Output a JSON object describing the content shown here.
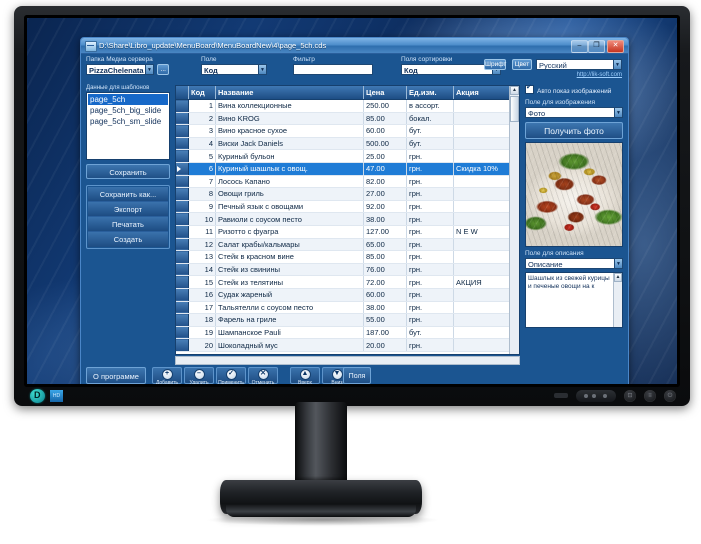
{
  "window": {
    "title": "D:\\Share\\Libro_update\\MenuBoard\\MenuBoardNew\\4\\page_5ch.cds",
    "minimize": "–",
    "maximize": "❐",
    "close": "✕"
  },
  "toolbar": {
    "media_folder_label": "Папка Медиа сервера",
    "media_folder_value": "PizzaChelenata",
    "browse_label": "...",
    "field_label": "Поле",
    "field_value": "Код",
    "filter_label": "Фильтр",
    "filter_value": "",
    "sort_label": "Поля сортировки",
    "sort_value": "Код",
    "font_button": "Шрифт",
    "color_button": "Цвет",
    "language_value": "Русский",
    "link": "http://lik-soft.com"
  },
  "left_panel": {
    "list_label": "Данные для шаблонов",
    "items": [
      {
        "label": "page_5ch",
        "selected": true
      },
      {
        "label": "page_5ch_big_slide",
        "selected": false
      },
      {
        "label": "page_5ch_sm_slide",
        "selected": false
      }
    ],
    "save": "Сохранить",
    "save_as": "Сохранить как...",
    "export": "Экспорт",
    "print": "Печатать",
    "create": "Создать"
  },
  "grid": {
    "columns": [
      "Код",
      "Название",
      "Цена",
      "Ед.изм.",
      "Акция"
    ],
    "rows": [
      {
        "code": "1",
        "name": "Вина коллекционные",
        "price": "250.00",
        "unit": "в ассорт.",
        "action": "",
        "selected": false
      },
      {
        "code": "2",
        "name": "Вино KROG",
        "price": "85.00",
        "unit": "бокал.",
        "action": "",
        "selected": false
      },
      {
        "code": "3",
        "name": "Вино красное сухое",
        "price": "60.00",
        "unit": "бут.",
        "action": "",
        "selected": false
      },
      {
        "code": "4",
        "name": "Виски Jack Daniels",
        "price": "500.00",
        "unit": "бут.",
        "action": "",
        "selected": false
      },
      {
        "code": "5",
        "name": "Куриный бульон",
        "price": "25.00",
        "unit": "грн.",
        "action": "",
        "selected": false
      },
      {
        "code": "6",
        "name": "Куриный шашлык с овощ.",
        "price": "47.00",
        "unit": "грн.",
        "action": "Скидка 10%",
        "selected": true
      },
      {
        "code": "7",
        "name": "Лосось Капано",
        "price": "82.00",
        "unit": "грн.",
        "action": "",
        "selected": false
      },
      {
        "code": "8",
        "name": "Овощи гриль",
        "price": "27.00",
        "unit": "грн.",
        "action": "",
        "selected": false
      },
      {
        "code": "9",
        "name": "Печный язык с овощами",
        "price": "92.00",
        "unit": "грн.",
        "action": "",
        "selected": false
      },
      {
        "code": "10",
        "name": "Равиоли с соусом песто",
        "price": "38.00",
        "unit": "грн.",
        "action": "",
        "selected": false
      },
      {
        "code": "11",
        "name": "Ризотто с фуагра",
        "price": "127.00",
        "unit": "грн.",
        "action": "N E W",
        "selected": false
      },
      {
        "code": "12",
        "name": "Салат крабы/кальмары",
        "price": "65.00",
        "unit": "грн.",
        "action": "",
        "selected": false
      },
      {
        "code": "13",
        "name": "Стейк в красном вине",
        "price": "85.00",
        "unit": "грн.",
        "action": "",
        "selected": false
      },
      {
        "code": "14",
        "name": "Стейк из свинины",
        "price": "76.00",
        "unit": "грн.",
        "action": "",
        "selected": false
      },
      {
        "code": "15",
        "name": "Стейк из телятины",
        "price": "72.00",
        "unit": "грн.",
        "action": "АКЦИЯ",
        "selected": false
      },
      {
        "code": "16",
        "name": "Судак жареный",
        "price": "60.00",
        "unit": "грн.",
        "action": "",
        "selected": false
      },
      {
        "code": "17",
        "name": "Тальятелли с соусом песто",
        "price": "38.00",
        "unit": "грн.",
        "action": "",
        "selected": false
      },
      {
        "code": "18",
        "name": "Фарель на гриле",
        "price": "55.00",
        "unit": "грн.",
        "action": "",
        "selected": false
      },
      {
        "code": "19",
        "name": "Шампанское Pauli",
        "price": "187.00",
        "unit": "бут.",
        "action": "",
        "selected": false
      },
      {
        "code": "20",
        "name": "Шоколадный мус",
        "price": "20.00",
        "unit": "грн.",
        "action": "",
        "selected": false
      }
    ]
  },
  "right_panel": {
    "auto_show_label": "Авто показ изображений",
    "image_field_label": "Поле для изображения",
    "image_field_value": "Фото",
    "get_photo_button": "Получить фото",
    "desc_field_label": "Поле для описания",
    "desc_field_value": "Описание",
    "desc_text": "Шашлык из свежей курицы и печеные овощи на к"
  },
  "bottom_bar": {
    "about": "О программе",
    "buttons": [
      {
        "label": "Добавить",
        "glyph": "+"
      },
      {
        "label": "Удалить",
        "glyph": "–"
      },
      {
        "label": "Применить",
        "glyph": "✓"
      },
      {
        "label": "Отменить",
        "glyph": "✕"
      },
      {
        "label": "Вверх",
        "glyph": "▲"
      },
      {
        "label": "Вниз",
        "glyph": "▼"
      }
    ],
    "fields": "Поля"
  },
  "monitor": {
    "badge_letter": "D",
    "badge2_text": "HD"
  },
  "colors": {
    "window_bg": "#1b5591",
    "title_bar": "#4e8ecb",
    "selection": "#1f7cd6",
    "close_button": "#c5341f"
  }
}
